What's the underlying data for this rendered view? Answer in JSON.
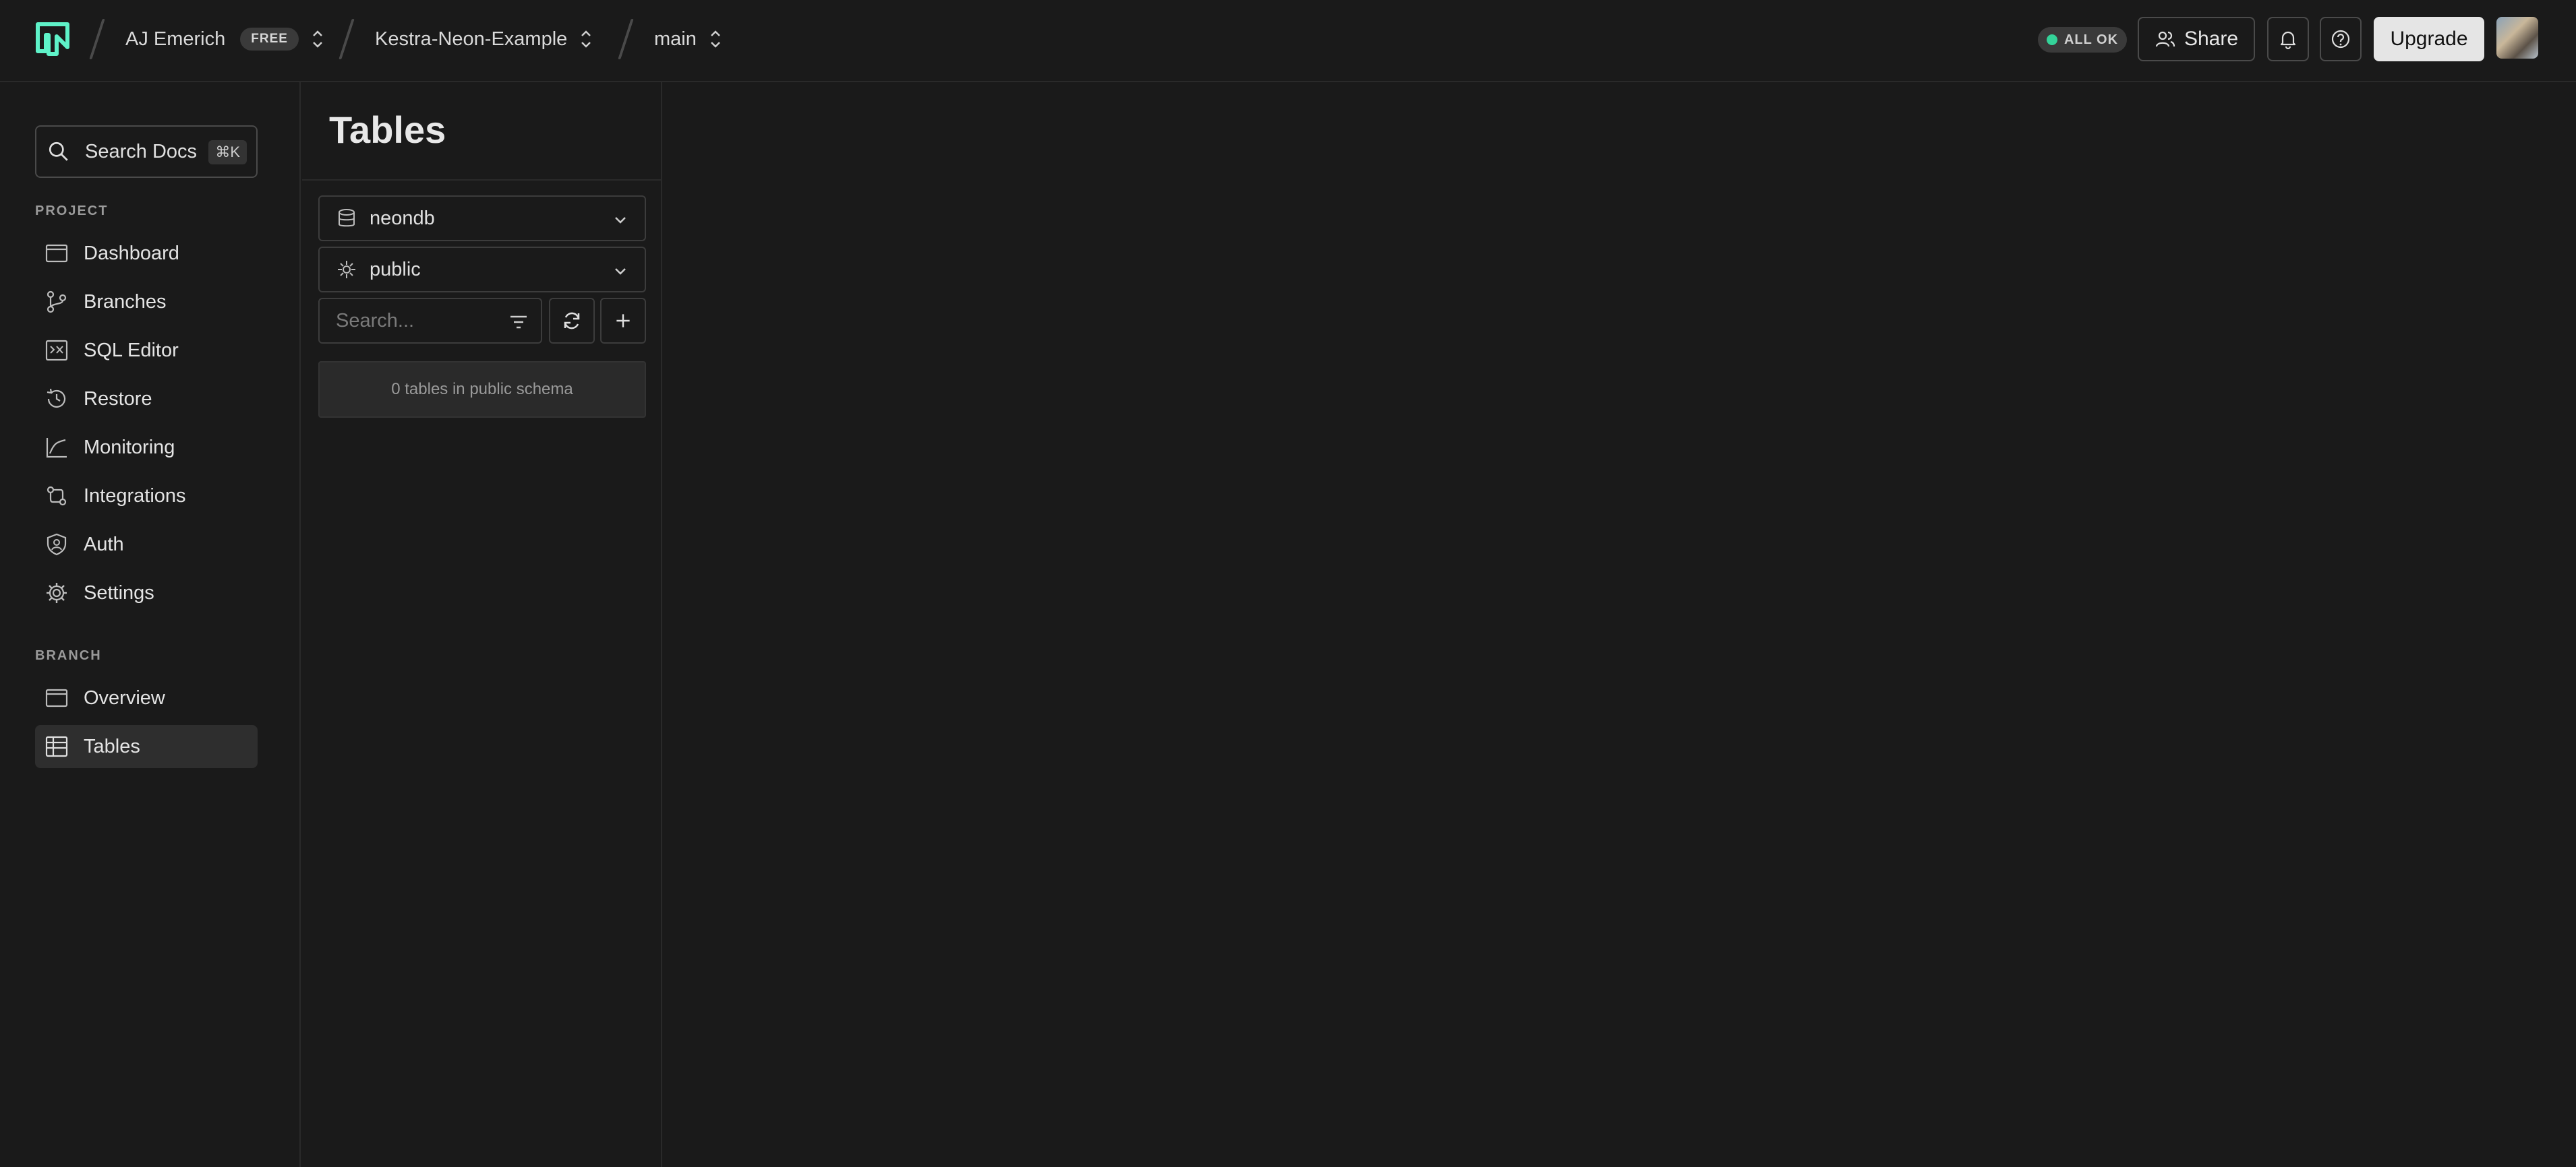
{
  "topbar": {
    "org_name": "AJ Emerich",
    "plan_badge": "FREE",
    "project_name": "Kestra-Neon-Example",
    "branch_name": "main",
    "status_text": "ALL OK",
    "share_label": "Share",
    "upgrade_label": "Upgrade",
    "logo_icon": "neon-logo-icon",
    "colors": {
      "accent": "#34d399",
      "logo": "#5ef2c8"
    }
  },
  "sidebar": {
    "search_label": "Search Docs",
    "search_shortcut": "⌘K",
    "project_section": "PROJECT",
    "project_items": [
      {
        "label": "Dashboard",
        "icon": "dashboard-icon"
      },
      {
        "label": "Branches",
        "icon": "branches-icon"
      },
      {
        "label": "SQL Editor",
        "icon": "sql-editor-icon"
      },
      {
        "label": "Restore",
        "icon": "restore-icon"
      },
      {
        "label": "Monitoring",
        "icon": "monitoring-icon"
      },
      {
        "label": "Integrations",
        "icon": "integrations-icon"
      },
      {
        "label": "Auth",
        "icon": "auth-icon"
      },
      {
        "label": "Settings",
        "icon": "settings-icon"
      }
    ],
    "branch_section": "BRANCH",
    "branch_items": [
      {
        "label": "Overview",
        "icon": "overview-icon"
      },
      {
        "label": "Tables",
        "icon": "tables-icon",
        "active": true
      }
    ]
  },
  "tables_panel": {
    "title": "Tables",
    "database": "neondb",
    "schema": "public",
    "search_placeholder": "Search...",
    "empty_message": "0 tables in public schema"
  }
}
